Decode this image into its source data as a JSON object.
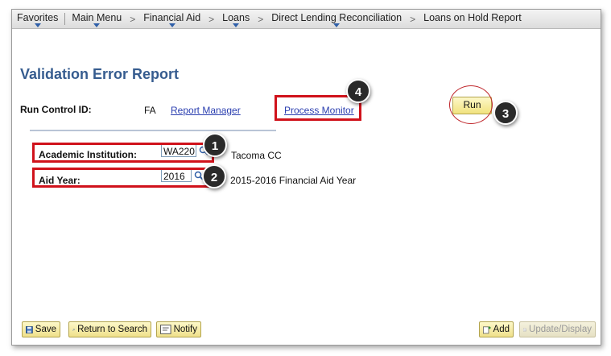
{
  "nav": {
    "items": [
      "Favorites",
      "Main Menu",
      "Financial Aid",
      "Loans",
      "Direct Lending Reconciliation",
      "Loans on Hold Report"
    ]
  },
  "page": {
    "title": "Validation Error Report",
    "run_control_label": "Run Control ID:",
    "run_control_value": "FA",
    "report_manager": "Report Manager",
    "process_monitor": "Process Monitor",
    "run": "Run"
  },
  "fields": {
    "institution_label": "Academic Institution:",
    "institution_value": "WA220",
    "institution_desc": "Tacoma CC",
    "aid_year_label": "Aid Year:",
    "aid_year_value": "2016",
    "aid_year_desc": "2015-2016 Financial Aid Year"
  },
  "callouts": [
    "1",
    "2",
    "3",
    "4"
  ],
  "toolbar": {
    "save": "Save",
    "return_to_search": "Return to Search",
    "notify": "Notify",
    "add": "Add",
    "update_display": "Update/Display"
  },
  "colors": {
    "title": "#365c8f",
    "link": "#2b3fb0",
    "highlight_red": "#d0121b",
    "button_yellow": "#f1e27e"
  }
}
